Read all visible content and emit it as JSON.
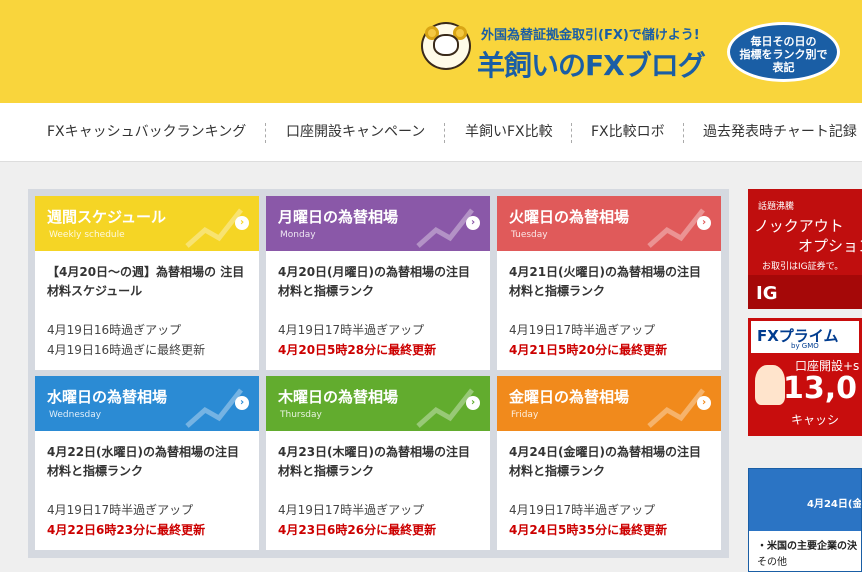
{
  "header": {
    "subtitle": "外国為替証拠金取引(FX)で儲けよう!",
    "title": "羊飼いのFXブログ",
    "bubble_lines": [
      "毎日その日の",
      "指標をランク別で",
      "表記"
    ]
  },
  "nav": [
    "FXキャッシュバックランキング",
    "口座開設キャンペーン",
    "羊飼いFX比較",
    "FX比較ロボ",
    "過去発表時チャート記録"
  ],
  "cards": [
    {
      "title": "週間スケジュール",
      "sub": "Weekly schedule",
      "color": "#f5d525",
      "desc": "【4月20日〜の週】為替相場の 注目材料スケジュール",
      "up": "4月19日16時過ぎアップ",
      "upd": "4月19日16時過ぎに最終更新",
      "upd_red": false
    },
    {
      "title": "月曜日の為替相場",
      "sub": "Monday",
      "color": "#8a58a8",
      "desc": "4月20日(月曜日)の為替相場の注目材料と指標ランク",
      "up": "4月19日17時半過ぎアップ",
      "upd": "4月20日5時28分に最終更新",
      "upd_red": true
    },
    {
      "title": "火曜日の為替相場",
      "sub": "Tuesday",
      "color": "#e05a5a",
      "desc": "4月21日(火曜日)の為替相場の注目材料と指標ランク",
      "up": "4月19日17時半過ぎアップ",
      "upd": "4月21日5時20分に最終更新",
      "upd_red": true
    },
    {
      "title": "水曜日の為替相場",
      "sub": "Wednesday",
      "color": "#2b8bd4",
      "desc": "4月22日(水曜日)の為替相場の注目材料と指標ランク",
      "up": "4月19日17時半過ぎアップ",
      "upd": "4月22日6時23分に最終更新",
      "upd_red": true
    },
    {
      "title": "木曜日の為替相場",
      "sub": "Thursday",
      "color": "#62ac2e",
      "desc": "4月23日(木曜日)の為替相場の注目材料と指標ランク",
      "up": "4月19日17時半過ぎアップ",
      "upd": "4月23日6時26分に最終更新",
      "upd_red": true
    },
    {
      "title": "金曜日の為替相場",
      "sub": "Friday",
      "color": "#f18a1c",
      "desc": "4月24日(金曜日)の為替相場の注目材料と指標ランク",
      "up": "4月19日17時半過ぎアップ",
      "upd": "4月24日5時35分に最終更新",
      "upd_red": true
    }
  ],
  "ads": {
    "ig": {
      "tag": "話題沸騰",
      "line1": "ノックアウト",
      "line2": "オプション",
      "line3": "お取引はIG証券で。",
      "brand": "IG"
    },
    "gmo": {
      "brand": "FXプライム",
      "by": "by GMO",
      "line1": "口座開設+s",
      "amount": "13,0",
      "line2": "キャッシ"
    },
    "news": {
      "date": "4月24日(金",
      "line1": "・米国の主要企業の決",
      "line2": "その他"
    }
  }
}
